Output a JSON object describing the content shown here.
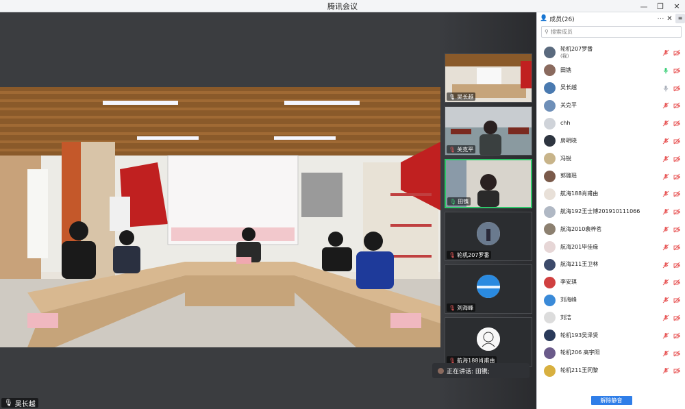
{
  "window": {
    "title": "腾讯会议"
  },
  "main_speaker": {
    "name": "吴长越"
  },
  "thumbnails": [
    {
      "name": "吴长越"
    },
    {
      "name": "关克平"
    },
    {
      "name": "田镌"
    },
    {
      "name": "轮机207罗番"
    },
    {
      "name": "刘海峰"
    },
    {
      "name": "航海188肖甫由"
    }
  ],
  "speaking": {
    "text": "正在讲话: 田镌;"
  },
  "panel": {
    "title": "成员(26)",
    "search_placeholder": "搜索成员",
    "members": [
      {
        "name": "轮机207罗番",
        "sub": "(我)",
        "color": "#5a6a7e"
      },
      {
        "name": "田镌",
        "sub": "",
        "color": "#8a6a5e"
      },
      {
        "name": "吴长越",
        "sub": "",
        "color": "#4a7ab0"
      },
      {
        "name": "关克平",
        "sub": "",
        "color": "#6e8fb8"
      },
      {
        "name": "chh",
        "sub": "",
        "color": "#cfd3d9"
      },
      {
        "name": "房明晓",
        "sub": "",
        "color": "#2e3540"
      },
      {
        "name": "冯锐",
        "sub": "",
        "color": "#c8b48a"
      },
      {
        "name": "郭璐瑶",
        "sub": "",
        "color": "#7a5a4a"
      },
      {
        "name": "航海188肖甫由",
        "sub": "",
        "color": "#e8e0d8"
      },
      {
        "name": "航海192王士博201910111066",
        "sub": "",
        "color": "#b0b8c4"
      },
      {
        "name": "航海2010裴梓茗",
        "sub": "",
        "color": "#8c8070"
      },
      {
        "name": "航海201毕佳缘",
        "sub": "",
        "color": "#e6d6d6"
      },
      {
        "name": "航海211王卫林",
        "sub": "",
        "color": "#3c4a6a"
      },
      {
        "name": "李安琪",
        "sub": "",
        "color": "#d04040"
      },
      {
        "name": "刘海峰",
        "sub": "",
        "color": "#3a8ad8"
      },
      {
        "name": "刘洁",
        "sub": "",
        "color": "#dcdcdc"
      },
      {
        "name": "轮机193吴泽贤",
        "sub": "",
        "color": "#2a3a5a"
      },
      {
        "name": "轮机206 高宇阳",
        "sub": "",
        "color": "#6a5a8a"
      },
      {
        "name": "轮机211王同黎",
        "sub": "",
        "color": "#d8b040"
      }
    ],
    "unmute_label": "解除静音"
  }
}
